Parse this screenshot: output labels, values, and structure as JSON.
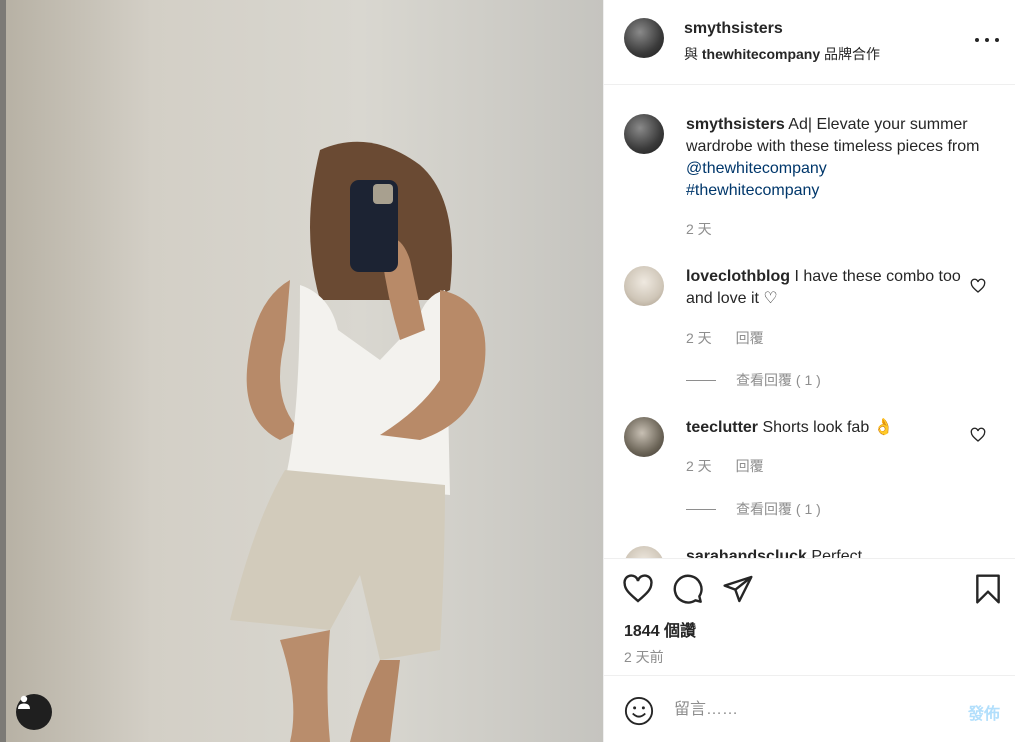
{
  "post": {
    "author": "smythsisters",
    "partnership_prefix": "與",
    "partner": "thewhitecompany",
    "partnership_suffix": "品牌合作"
  },
  "caption": {
    "author": "smythsisters",
    "text": "Ad| Elevate your summer wardrobe with these timeless pieces from",
    "mention": "@thewhitecompany",
    "hashtag": "#thewhitecompany",
    "time": "2 天"
  },
  "comments": [
    {
      "user": "loveclothblog",
      "text": "I have these combo too and love it ♡",
      "time": "2 天",
      "reply_label": "回覆",
      "view_replies": "查看回覆 ( 1 )"
    },
    {
      "user": "teeclutter",
      "text": "Shorts look fab 👌",
      "time": "2 天",
      "reply_label": "回覆",
      "view_replies": "查看回覆 ( 1 )"
    },
    {
      "user": "sarahandscluck",
      "text": "Perfect"
    }
  ],
  "stats": {
    "likes": "1844 個讚",
    "posted": "2 天前"
  },
  "composer": {
    "placeholder": "留言……",
    "post_label": "發佈"
  },
  "icons": [
    "user-tag-icon",
    "more-options-icon",
    "heart-icon",
    "comment-icon",
    "share-icon",
    "bookmark-icon",
    "emoji-icon"
  ],
  "colors": {
    "link": "#00376b",
    "muted": "#8e8e8e",
    "post_button": "#b2dffc"
  }
}
